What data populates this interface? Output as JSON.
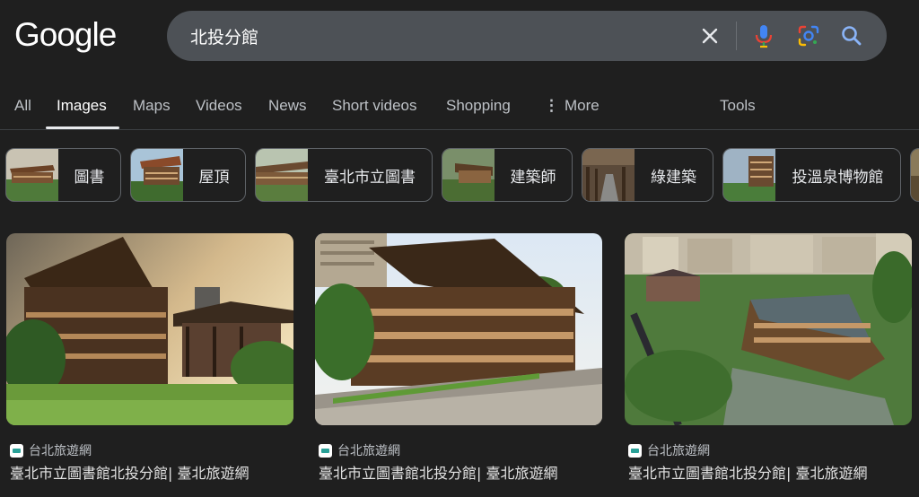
{
  "header": {
    "logo": "Google",
    "search": {
      "query": "北投分館"
    },
    "icons": [
      "clear-icon",
      "mic-icon",
      "google-lens-icon",
      "search-icon"
    ]
  },
  "tabs": {
    "all": "All",
    "images": "Images",
    "maps": "Maps",
    "videos": "Videos",
    "news": "News",
    "short_videos": "Short videos",
    "shopping": "Shopping",
    "more": "More",
    "tools": "Tools",
    "active": "Images"
  },
  "chips": [
    {
      "label": "圖書"
    },
    {
      "label": "屋頂"
    },
    {
      "label": "臺北市立圖書"
    },
    {
      "label": "建築師"
    },
    {
      "label": "綠建築"
    },
    {
      "label": "投溫泉博物館"
    }
  ],
  "results": [
    {
      "source": "台北旅遊網",
      "title": "臺北市立圖書館北投分館| 臺北旅遊網"
    },
    {
      "source": "台北旅遊網",
      "title": "臺北市立圖書館北投分館| 臺北旅遊網"
    },
    {
      "source": "台北旅遊網",
      "title": "臺北市立圖書館北投分館| 臺北旅遊網"
    }
  ],
  "colors": {
    "background": "#1f1f1f",
    "searchbar": "#4d5156",
    "accent_blue": "#8ab4f8"
  }
}
